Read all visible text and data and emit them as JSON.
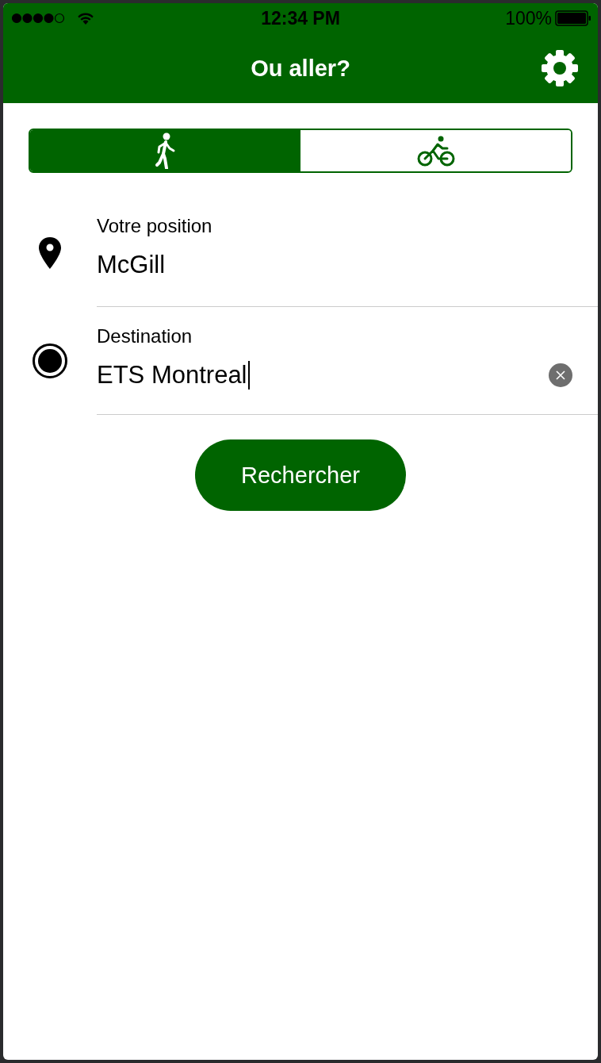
{
  "status_bar": {
    "time": "12:34 PM",
    "battery": "100%"
  },
  "header": {
    "title": "Ou aller?"
  },
  "modes": [
    {
      "kind": "walk",
      "selected": true
    },
    {
      "kind": "bike",
      "selected": false
    }
  ],
  "fields": [
    {
      "kind": "pin",
      "label": "Votre position",
      "value": "McGill",
      "focused": false
    },
    {
      "kind": "target",
      "label": "Destination",
      "value": "ETS Montreal",
      "focused": true
    }
  ],
  "search_button": "Rechercher"
}
